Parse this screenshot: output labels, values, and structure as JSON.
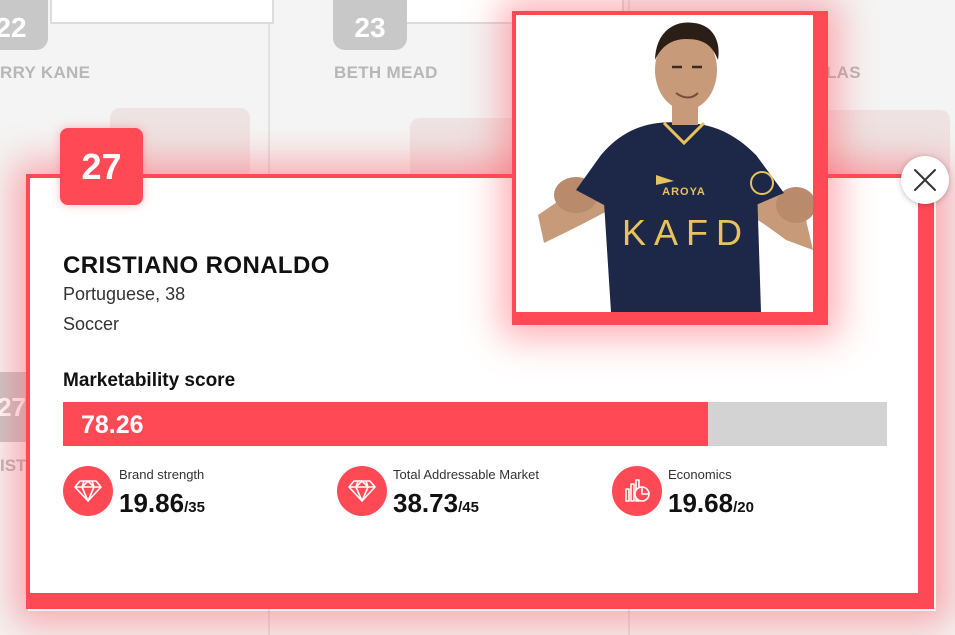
{
  "background": {
    "cards": [
      {
        "rank": "22",
        "name": "RRY KANE"
      },
      {
        "rank": "23",
        "name": "BETH MEAD"
      },
      {
        "rank": "",
        "name": "LAS"
      }
    ],
    "left_rank": "27",
    "left_name": "IST"
  },
  "player": {
    "rank": "27",
    "name": "CRISTIANO RONALDO",
    "meta": "Portuguese, 38",
    "sport": "Soccer",
    "jersey_text": "KAFD",
    "jersey_sponsor": "AROYA"
  },
  "score": {
    "title": "Marketability score",
    "value": "78.26",
    "fraction": 0.7826
  },
  "metrics": [
    {
      "label": "Brand strength",
      "value": "19.86",
      "max": "/35",
      "icon": "diamond-icon"
    },
    {
      "label": "Total Addressable Market",
      "value": "38.73",
      "max": "/45",
      "icon": "diamond-icon"
    },
    {
      "label": "Economics",
      "value": "19.68",
      "max": "/20",
      "icon": "chart-pie-icon"
    }
  ],
  "close": {
    "icon": "close-icon"
  },
  "colors": {
    "accent": "#ff4a55",
    "track": "#d3d3d3",
    "jersey": "#1d2748"
  }
}
